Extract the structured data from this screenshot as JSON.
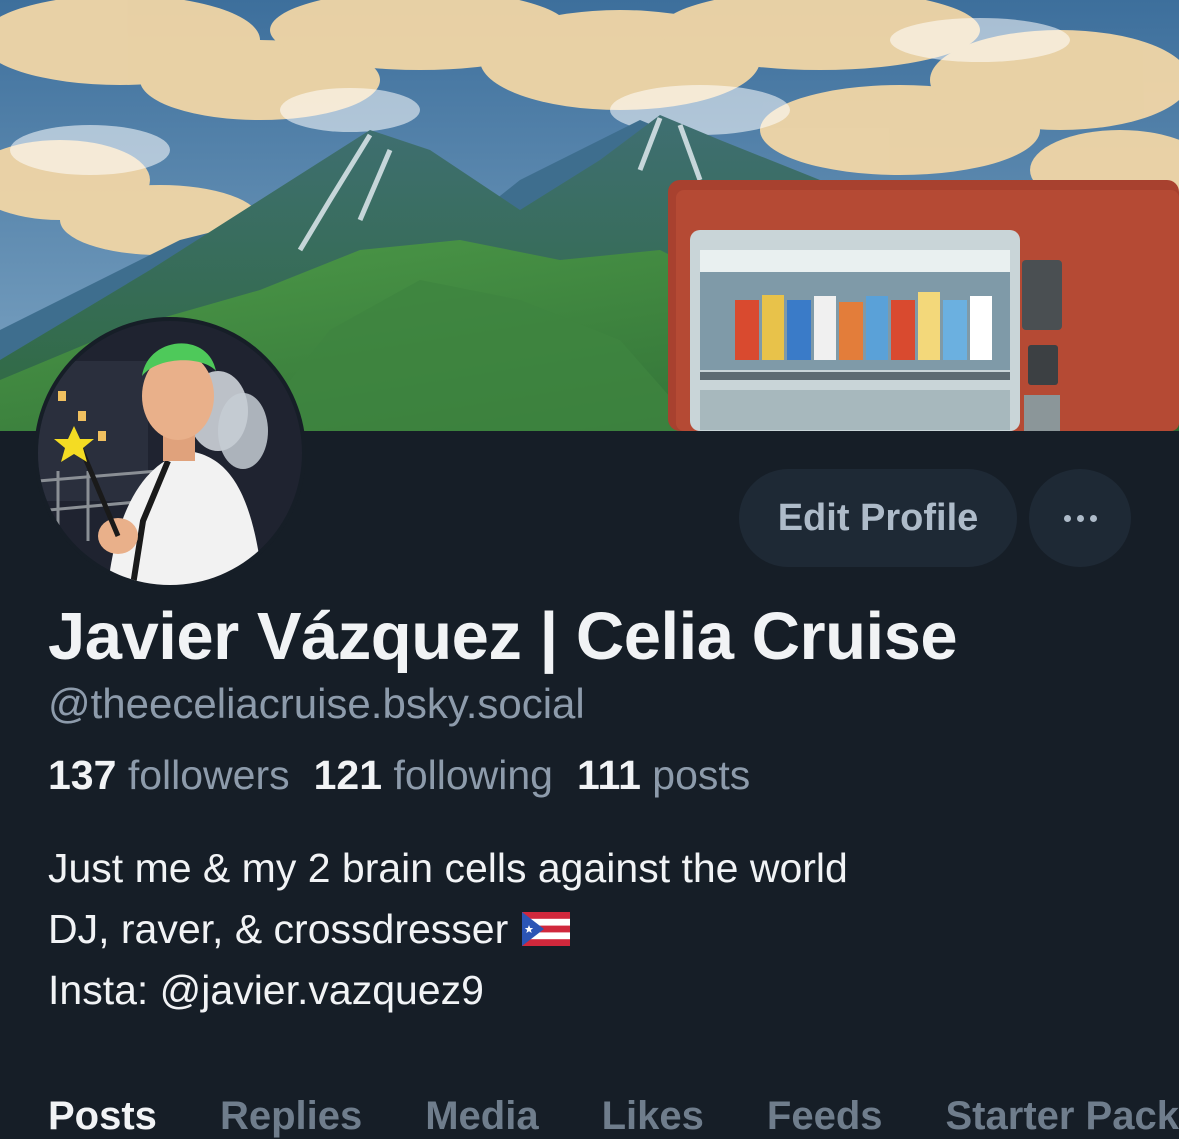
{
  "profile": {
    "display_name": "Javier Vázquez | Celia Cruise",
    "handle": "@theeceliacruise.bsky.social",
    "banner_icon": "mountain-vending-machine-illustration",
    "avatar_icon": "person-avatar-photo"
  },
  "actions": {
    "edit_profile_label": "Edit Profile",
    "more_icon": "ellipsis-icon"
  },
  "stats": {
    "followers_count": "137",
    "followers_label": "followers",
    "following_count": "121",
    "following_label": "following",
    "posts_count": "111",
    "posts_label": "posts"
  },
  "bio": {
    "line1": "Just me & my 2 brain cells against the world",
    "line2": "DJ, raver, & crossdresser",
    "line2_icon": "puerto-rico-flag-icon",
    "line3": "Insta: @javier.vazquez9"
  },
  "tabs": [
    "Posts",
    "Replies",
    "Media",
    "Likes",
    "Feeds",
    "Starter Packs"
  ],
  "colors": {
    "background": "#161e27",
    "button_bg": "#1e2935",
    "muted_text": "#8d9bab",
    "primary_text": "#f1f3f5"
  }
}
